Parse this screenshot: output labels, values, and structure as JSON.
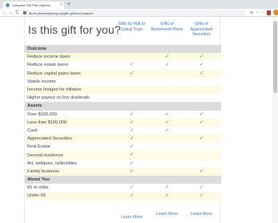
{
  "browser": {
    "tab_title": "Compare Gift Plan Options",
    "tab_close": "×",
    "new_tab": "+",
    "url": "demo.plannedgiving.org/gift-options/compare",
    "nav": {
      "back": "←",
      "forward": "→",
      "reload": "C"
    },
    "toolbar_icons": [
      "⊕",
      "☆",
      "⋯"
    ]
  },
  "page": {
    "heading": "Is this gift for you?",
    "columns": [
      {
        "label": "Gifts by Will or Living Trust"
      },
      {
        "label": "Gifts of Retirement Plans"
      },
      {
        "label": "Gifts of Appreciated Securities"
      }
    ],
    "check_glyph": "✓",
    "rows": [
      {
        "type": "header",
        "label": "Outcome",
        "checks": [
          false,
          false,
          false
        ]
      },
      {
        "type": "yellow",
        "label": "Reduce income taxes",
        "checks": [
          false,
          true,
          true
        ]
      },
      {
        "type": "white",
        "label": "Reduce estate taxes",
        "checks": [
          true,
          true,
          true
        ]
      },
      {
        "type": "yellow",
        "label": "Reduce capital gains taxes",
        "checks": [
          true,
          false,
          true
        ]
      },
      {
        "type": "white",
        "label": "Stable income",
        "checks": [
          false,
          false,
          false
        ]
      },
      {
        "type": "yellow",
        "label": "Income hedged for inflation",
        "checks": [
          false,
          false,
          false
        ]
      },
      {
        "type": "white",
        "label": "Higher payout on low dividends",
        "checks": [
          false,
          false,
          false
        ]
      },
      {
        "type": "header",
        "label": "Assets",
        "checks": [
          false,
          false,
          false
        ]
      },
      {
        "type": "white",
        "label": "Over $100,000",
        "checks": [
          true,
          true,
          true
        ]
      },
      {
        "type": "yellow",
        "label": "Less than $100,000",
        "checks": [
          true,
          true,
          true
        ]
      },
      {
        "type": "white",
        "label": "Cash",
        "checks": [
          true,
          true,
          false
        ]
      },
      {
        "type": "yellow",
        "label": "Appreciated Securities",
        "checks": [
          true,
          false,
          true
        ]
      },
      {
        "type": "white",
        "label": "Real Estate",
        "checks": [
          true,
          false,
          false
        ]
      },
      {
        "type": "yellow",
        "label": "Second residence",
        "checks": [
          true,
          false,
          false
        ]
      },
      {
        "type": "white",
        "label": "Art, antiques, collectibles",
        "checks": [
          true,
          false,
          false
        ]
      },
      {
        "type": "yellow",
        "label": "Family business",
        "checks": [
          true,
          false,
          true
        ]
      },
      {
        "type": "header",
        "label": "About You",
        "checks": [
          false,
          false,
          false
        ]
      },
      {
        "type": "white",
        "label": "65 or older",
        "checks": [
          true,
          true,
          true
        ]
      },
      {
        "type": "yellow",
        "label": "Under 65",
        "checks": [
          true,
          true,
          true
        ]
      }
    ],
    "learn_more": [
      "Learn More",
      "Learn More",
      "Learn More"
    ]
  }
}
